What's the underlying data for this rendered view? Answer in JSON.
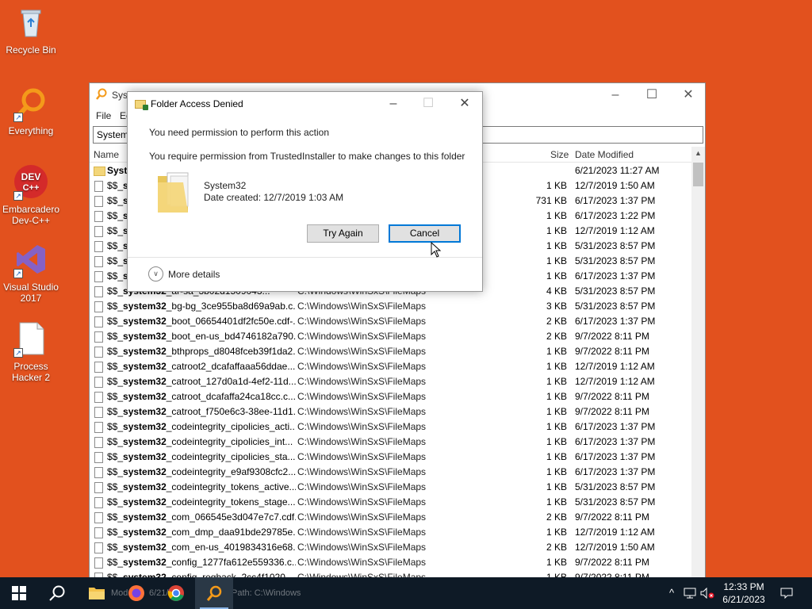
{
  "desktop": {
    "icons": [
      {
        "label": "Recycle Bin",
        "icon": "recycle-bin-icon"
      },
      {
        "label": "Everything",
        "icon": "everything-magnifier-icon"
      },
      {
        "label": "Embarcadero Dev-C++",
        "icon": "devcpp-icon",
        "badge": "DEV C++"
      },
      {
        "label": "Visual Studio 2017",
        "icon": "visual-studio-icon"
      },
      {
        "label": "Process Hacker 2",
        "icon": "document-icon"
      }
    ]
  },
  "everything": {
    "title": "Syst",
    "menu": [
      "File",
      "Ec"
    ],
    "search": "System3",
    "columns": {
      "name": "Name",
      "size": "Size",
      "date": "Date Modified"
    },
    "rows": [
      {
        "bold": "Syste",
        "rest": "",
        "path": "",
        "size": "",
        "date": "6/21/2023 11:27 AM",
        "folder": true
      },
      {
        "prefix": "$$_",
        "bold": "sy",
        "rest": "",
        "path": "",
        "size": "1 KB",
        "date": "12/7/2019 1:50 AM"
      },
      {
        "prefix": "$$_",
        "bold": "sy",
        "rest": "",
        "path": "",
        "size": "731 KB",
        "date": "6/17/2023 1:37 PM"
      },
      {
        "prefix": "$$_",
        "bold": "sy",
        "rest": "",
        "path": "",
        "size": "1 KB",
        "date": "6/17/2023 1:22 PM"
      },
      {
        "prefix": "$$_",
        "bold": "sy",
        "rest": "",
        "path": "",
        "size": "1 KB",
        "date": "12/7/2019 1:12 AM"
      },
      {
        "prefix": "$$_",
        "bold": "sy",
        "rest": "",
        "path": "",
        "size": "1 KB",
        "date": "5/31/2023 8:57 PM"
      },
      {
        "prefix": "$$_",
        "bold": "sy",
        "rest": "",
        "path": "",
        "size": "1 KB",
        "date": "5/31/2023 8:57 PM"
      },
      {
        "prefix": "$$_",
        "bold": "sy",
        "rest": "",
        "path": "",
        "size": "1 KB",
        "date": "6/17/2023 1:37 PM"
      },
      {
        "prefix": "$$_",
        "bold": "system32",
        "rest": "_ar-sa_3b02d1509043...",
        "path": "C:\\Windows\\WinSxS\\FileMaps",
        "size": "4 KB",
        "date": "5/31/2023 8:57 PM"
      },
      {
        "prefix": "$$_",
        "bold": "system32",
        "rest": "_bg-bg_3ce955ba8d69a9ab.c...",
        "path": "C:\\Windows\\WinSxS\\FileMaps",
        "size": "3 KB",
        "date": "5/31/2023 8:57 PM"
      },
      {
        "prefix": "$$_",
        "bold": "system32",
        "rest": "_boot_06654401df2fc50e.cdf-...",
        "path": "C:\\Windows\\WinSxS\\FileMaps",
        "size": "2 KB",
        "date": "6/17/2023 1:37 PM"
      },
      {
        "prefix": "$$_",
        "bold": "system32",
        "rest": "_boot_en-us_bd4746182a790...",
        "path": "C:\\Windows\\WinSxS\\FileMaps",
        "size": "2 KB",
        "date": "9/7/2022 8:11 PM"
      },
      {
        "prefix": "$$_",
        "bold": "system32",
        "rest": "_bthprops_d8048fceb39f1da2...",
        "path": "C:\\Windows\\WinSxS\\FileMaps",
        "size": "1 KB",
        "date": "9/7/2022 8:11 PM"
      },
      {
        "prefix": "$$_",
        "bold": "system32",
        "rest": "_catroot2_dcafaffaaa56ddae....",
        "path": "C:\\Windows\\WinSxS\\FileMaps",
        "size": "1 KB",
        "date": "12/7/2019 1:12 AM"
      },
      {
        "prefix": "$$_",
        "bold": "system32",
        "rest": "_catroot_127d0a1d-4ef2-11d...",
        "path": "C:\\Windows\\WinSxS\\FileMaps",
        "size": "1 KB",
        "date": "12/7/2019 1:12 AM"
      },
      {
        "prefix": "$$_",
        "bold": "system32",
        "rest": "_catroot_dcafaffa24ca18cc.c...",
        "path": "C:\\Windows\\WinSxS\\FileMaps",
        "size": "1 KB",
        "date": "9/7/2022 8:11 PM"
      },
      {
        "prefix": "$$_",
        "bold": "system32",
        "rest": "_catroot_f750e6c3-38ee-11d1...",
        "path": "C:\\Windows\\WinSxS\\FileMaps",
        "size": "1 KB",
        "date": "9/7/2022 8:11 PM"
      },
      {
        "prefix": "$$_",
        "bold": "system32",
        "rest": "_codeintegrity_cipolicies_acti...",
        "path": "C:\\Windows\\WinSxS\\FileMaps",
        "size": "1 KB",
        "date": "6/17/2023 1:37 PM"
      },
      {
        "prefix": "$$_",
        "bold": "system32",
        "rest": "_codeintegrity_cipolicies_int...",
        "path": "C:\\Windows\\WinSxS\\FileMaps",
        "size": "1 KB",
        "date": "6/17/2023 1:37 PM"
      },
      {
        "prefix": "$$_",
        "bold": "system32",
        "rest": "_codeintegrity_cipolicies_sta...",
        "path": "C:\\Windows\\WinSxS\\FileMaps",
        "size": "1 KB",
        "date": "6/17/2023 1:37 PM"
      },
      {
        "prefix": "$$_",
        "bold": "system32",
        "rest": "_codeintegrity_e9af9308cfc2...",
        "path": "C:\\Windows\\WinSxS\\FileMaps",
        "size": "1 KB",
        "date": "6/17/2023 1:37 PM"
      },
      {
        "prefix": "$$_",
        "bold": "system32",
        "rest": "_codeintegrity_tokens_active...",
        "path": "C:\\Windows\\WinSxS\\FileMaps",
        "size": "1 KB",
        "date": "5/31/2023 8:57 PM"
      },
      {
        "prefix": "$$_",
        "bold": "system32",
        "rest": "_codeintegrity_tokens_stage...",
        "path": "C:\\Windows\\WinSxS\\FileMaps",
        "size": "1 KB",
        "date": "5/31/2023 8:57 PM"
      },
      {
        "prefix": "$$_",
        "bold": "system32",
        "rest": "_com_066545e3d047e7c7.cdf...",
        "path": "C:\\Windows\\WinSxS\\FileMaps",
        "size": "2 KB",
        "date": "9/7/2022 8:11 PM"
      },
      {
        "prefix": "$$_",
        "bold": "system32",
        "rest": "_com_dmp_daa91bde29785e...",
        "path": "C:\\Windows\\WinSxS\\FileMaps",
        "size": "1 KB",
        "date": "12/7/2019 1:12 AM"
      },
      {
        "prefix": "$$_",
        "bold": "system32",
        "rest": "_com_en-us_4019834316e68...",
        "path": "C:\\Windows\\WinSxS\\FileMaps",
        "size": "2 KB",
        "date": "12/7/2019 1:50 AM"
      },
      {
        "prefix": "$$_",
        "bold": "system32",
        "rest": "_config_1277fa612e559336.c...",
        "path": "C:\\Windows\\WinSxS\\FileMaps",
        "size": "1 KB",
        "date": "9/7/2022 8:11 PM"
      },
      {
        "prefix": "$$_",
        "bold": "system32",
        "rest": "_config_regback_2cc4f1020...",
        "path": "C:\\Windows\\WinSxS\\FileMaps",
        "size": "1 KB",
        "date": "9/7/2022 8:11 PM"
      }
    ]
  },
  "dialog": {
    "title": "Folder Access Denied",
    "message1": "You need permission to perform this action",
    "message2": "You require permission from TrustedInstaller to make changes to this folder",
    "folder_name": "System32",
    "folder_date": "Date created: 12/7/2019 1:03 AM",
    "try_again": "Try Again",
    "cancel": "Cancel",
    "more_details": "More details"
  },
  "taskbar": {
    "ghost_text_1": "Mod",
    "ghost_text_2": "6/21/202",
    "ghost_text_3": "Path: C:\\Windows",
    "time": "12:33 PM",
    "date": "6/21/2023"
  },
  "colors": {
    "desktop": "#e2511e",
    "taskbar": "#0e1a26",
    "accent": "#0078d7"
  }
}
